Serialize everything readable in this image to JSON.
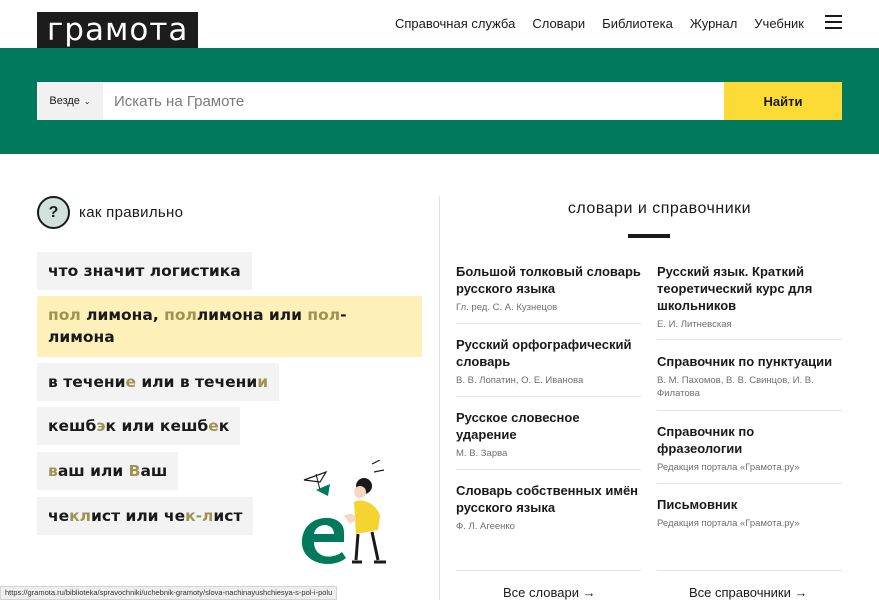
{
  "header": {
    "logo": "грамота",
    "nav": [
      "Справочная служба",
      "Словари",
      "Библиотека",
      "Журнал",
      "Учебник"
    ]
  },
  "search": {
    "scope": "Везде",
    "placeholder": "Искать на Грамоте",
    "button": "Найти"
  },
  "how": {
    "title": "как правильно",
    "qmark": "?",
    "items": [
      {
        "parts": [
          "что значит логистика"
        ]
      },
      {
        "parts": [
          "пол",
          " лимона, ",
          "пол",
          "лимона или ",
          "пол",
          "-",
          "лимона"
        ]
      },
      {
        "parts": [
          "в течени",
          "е",
          " или в течени",
          "и"
        ]
      },
      {
        "parts": [
          "кешб",
          "э",
          "к или кешб",
          "е",
          "к"
        ]
      },
      {
        "parts": [
          "в",
          "аш или ",
          "В",
          "аш"
        ]
      },
      {
        "parts": [
          "че",
          "кл",
          "ист или че",
          "к-л",
          "ист"
        ]
      }
    ]
  },
  "dicts": {
    "title": "словари и справочники",
    "left": [
      {
        "name": "Большой толковый словарь русского языка",
        "auth": "Гл. ред. С. А. Кузнецов"
      },
      {
        "name": "Русский орфографический словарь",
        "auth": "В. В. Лопатин, О. Е. Иванова"
      },
      {
        "name": "Русское словесное ударение",
        "auth": "М. В. Зарва"
      },
      {
        "name": "Словарь собственных имён русского языка",
        "auth": "Ф. Л. Агеенко"
      }
    ],
    "right": [
      {
        "name": "Русский язык. Краткий теоретический курс для школьников",
        "auth": "Е. И. Литневская"
      },
      {
        "name": "Справочник по пунктуации",
        "auth": "В. М. Пахомов, В. В. Свинцов, И. В. Филатова"
      },
      {
        "name": "Справочник по фразеологии",
        "auth": "Редакция портала «Грамота.ру»"
      },
      {
        "name": "Письмовник",
        "auth": "Редакция портала «Грамота.ру»"
      }
    ],
    "all_dicts": "Все словари →",
    "all_refs": "Все справочники →"
  },
  "status_url": "https://gramota.ru/biblioteka/spravochniki/uchebnik-gramoty/slova-nachinayushchiesya-s-pol-i-polu",
  "colors": {
    "band": "#00795d",
    "button": "#fddb36",
    "highlight": "#fdf0b8",
    "accent_letter": "#9f9354"
  }
}
